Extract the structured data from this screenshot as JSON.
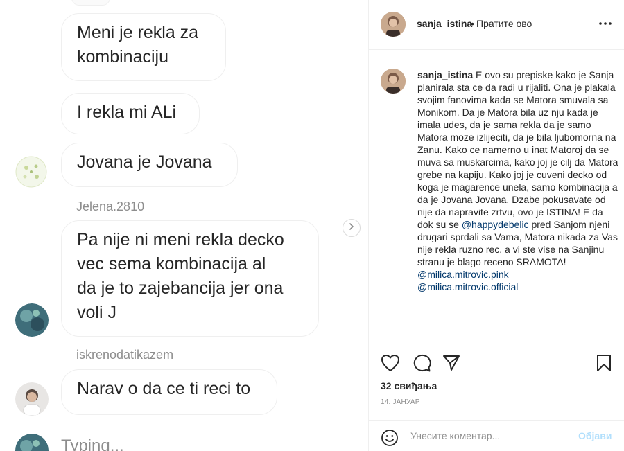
{
  "chat": {
    "messages": [
      {
        "text": "Meni je rekla za\nkombinaciju"
      },
      {
        "text": "I rekla mi ALi"
      },
      {
        "text": "Jovana je Jovana"
      },
      {
        "sender": "Jelena.2810",
        "text": "Pa nije ni meni rekla decko\nvec sema kombinacija al\nda je to zajebancija jer ona\nvoli J"
      },
      {
        "sender": "iskrenodatikazem",
        "text": "Narav o da ce ti reci to"
      }
    ],
    "typing": "Typing..."
  },
  "post": {
    "username": "sanja_istina",
    "separator": "•",
    "follow_label": "Пратите ово",
    "caption": {
      "username": "sanja_istina",
      "text_before": " E ovo su prepiske kako je Sanja planirala sta ce da radi u rijaliti. Ona je plakala svojim fanovima kada se Matora smuvala sa Monikom. Da je Matora bila uz nju kada je imala udes, da je sama rekla da je samo Matora moze izlijeciti, da je bila ljubomorna na Zanu. Kako ce namerno u inat Matoroj da se muva sa muskarcima, kako joj je cilj da Matora grebe na kapiju. Kako joj je cuveni decko od koga je magarence unela, samo kombinacija a da je Jovana Jovana. Dzabe pokusavate od nije da napravite zrtvu, ovo je ISTINA! E da dok su se ",
      "mention_1": "@happydebelic",
      "text_after": " pred Sanjom njeni drugari sprdali sa Vama, Matora nikada za Vas nije rekla ruzno rec, a vi ste vise na Sanjinu stranu je blago receno SRAMOTA!",
      "mention_2": "@milica.mitrovic.pink",
      "mention_3": "@milica.mitrovic.official"
    },
    "likes": "32 свиђања",
    "date": "14. ЈАНУАР",
    "comment_placeholder": "Унесите коментар...",
    "post_button": "Објави"
  },
  "icons": {
    "more": "more-icon",
    "heart": "heart-icon",
    "comment": "comment-icon",
    "share": "share-icon",
    "save": "bookmark-icon",
    "emoji": "emoji-icon",
    "next": "chevron-right-icon"
  },
  "colors": {
    "text": "#262626",
    "secondary": "#8e8e8e",
    "mention": "#00376b",
    "post_button_disabled": "#b2dffc",
    "bubble_border": "#efefef"
  }
}
